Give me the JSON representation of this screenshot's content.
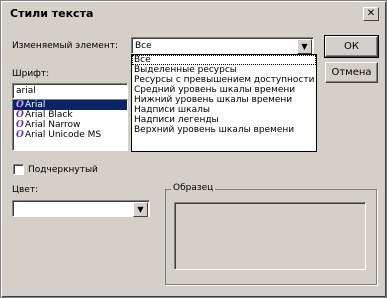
{
  "window": {
    "title": "Стили текста",
    "close": "✕"
  },
  "element": {
    "label": "Изменяемый элемент:",
    "value": "Все",
    "options": [
      "Все",
      "Выделенные ресурсы",
      "Ресурсы с превышением доступности",
      "Средний уровень шкалы времени",
      "Нижний уровень шкалы времени",
      "Надписи шкалы",
      "Надписи легенды",
      "Верхний уровень шкалы времени"
    ]
  },
  "buttons": {
    "ok": "ОК",
    "cancel": "Отмена"
  },
  "font": {
    "label": "Шрифт:",
    "value": "arial",
    "items": [
      "Arial",
      "Arial Black",
      "Arial Narrow",
      "Arial Unicode MS"
    ],
    "selected_index": 0
  },
  "underline": {
    "label": "Подчеркнутый",
    "checked": false
  },
  "color": {
    "label": "Цвет:",
    "value": ""
  },
  "sample": {
    "label": "Образец"
  },
  "icons": {
    "dropdown": "▼",
    "truetype": "O"
  }
}
